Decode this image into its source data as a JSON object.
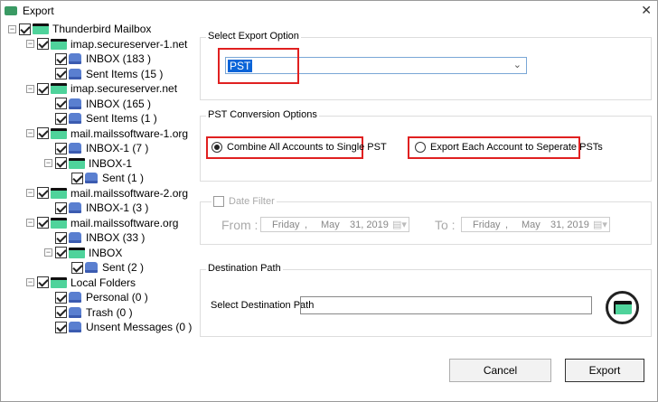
{
  "window": {
    "title": "Export"
  },
  "tree": [
    {
      "label": "Thunderbird Mailbox",
      "level": 0,
      "kind": "root",
      "expand": true
    },
    {
      "label": "imap.secureserver-1.net",
      "level": 1,
      "kind": "folder",
      "expand": true
    },
    {
      "label": "INBOX (183 )",
      "level": 2,
      "kind": "mail"
    },
    {
      "label": "Sent Items (15 )",
      "level": 2,
      "kind": "mail"
    },
    {
      "label": "imap.secureserver.net",
      "level": 1,
      "kind": "folder",
      "expand": true
    },
    {
      "label": "INBOX (165 )",
      "level": 2,
      "kind": "mail"
    },
    {
      "label": "Sent Items (1 )",
      "level": 2,
      "kind": "mail"
    },
    {
      "label": "mail.mailssoftware-1.org",
      "level": 1,
      "kind": "folder",
      "expand": true
    },
    {
      "label": "INBOX-1 (7 )",
      "level": 2,
      "kind": "mail"
    },
    {
      "label": "INBOX-1",
      "level": 2,
      "kind": "folder",
      "expand": true
    },
    {
      "label": "Sent (1 )",
      "level": 3,
      "kind": "mail"
    },
    {
      "label": "mail.mailssoftware-2.org",
      "level": 1,
      "kind": "folder",
      "expand": true
    },
    {
      "label": "INBOX-1 (3 )",
      "level": 2,
      "kind": "mail"
    },
    {
      "label": "mail.mailssoftware.org",
      "level": 1,
      "kind": "folder",
      "expand": true
    },
    {
      "label": "INBOX (33 )",
      "level": 2,
      "kind": "mail"
    },
    {
      "label": "INBOX",
      "level": 2,
      "kind": "folder",
      "expand": true
    },
    {
      "label": "Sent (2 )",
      "level": 3,
      "kind": "mail"
    },
    {
      "label": "Local Folders",
      "level": 1,
      "kind": "folder",
      "expand": true
    },
    {
      "label": "Personal (0 )",
      "level": 2,
      "kind": "mail"
    },
    {
      "label": "Trash (0 )",
      "level": 2,
      "kind": "mail"
    },
    {
      "label": "Unsent Messages (0 )",
      "level": 2,
      "kind": "mail"
    }
  ],
  "export_option": {
    "legend": "Select Export Option",
    "value": "PST"
  },
  "pst_options": {
    "legend": "PST Conversion Options",
    "combine": "Combine All Accounts to Single PST",
    "separate": "Export Each Account to Seperate PSTs",
    "selected": "combine"
  },
  "date_filter": {
    "label": "Date Filter",
    "checked": false,
    "from_label": "From :",
    "to_label": "To :",
    "from": {
      "day": "Friday",
      "sep": ",",
      "month": "May",
      "date": "31, 2019"
    },
    "to": {
      "day": "Friday",
      "sep": ",",
      "month": "May",
      "date": "31, 2019"
    }
  },
  "destination": {
    "legend": "Destination Path",
    "label": "Select Destination Path",
    "value": ""
  },
  "buttons": {
    "cancel": "Cancel",
    "export": "Export"
  },
  "colors": {
    "highlight": "#e02020",
    "folder": "#4fd39b",
    "selection": "#0a64d8"
  }
}
